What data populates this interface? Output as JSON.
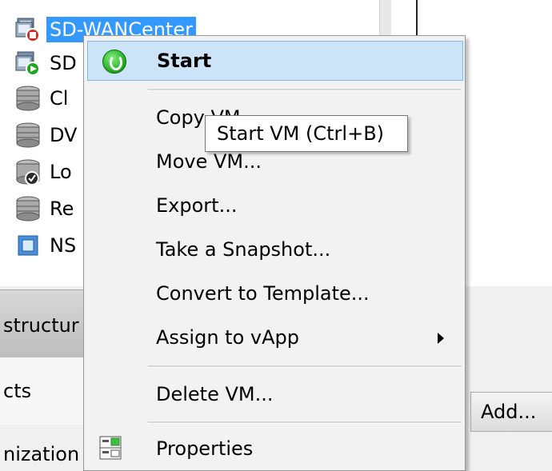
{
  "tree": {
    "items": [
      {
        "label": "SD-WANCenter",
        "icon": "vm-stopped-icon",
        "selected": true
      },
      {
        "label": "SD",
        "icon": "vm-running-icon"
      },
      {
        "label": "Cl",
        "icon": "server-stack-icon"
      },
      {
        "label": "DV",
        "icon": "server-stack-icon"
      },
      {
        "label": "Lo",
        "icon": "server-check-icon"
      },
      {
        "label": "Re",
        "icon": "server-stack-icon"
      },
      {
        "label": "NS",
        "icon": "template-icon"
      }
    ]
  },
  "bottom_nav": {
    "infrastructure": "structur",
    "objects": "cts",
    "organization": "nization",
    "add_button": "Add..."
  },
  "context_menu": {
    "items": [
      {
        "label": "Start",
        "icon": "start-icon",
        "highlighted": true
      },
      {
        "label": "Copy VM..."
      },
      {
        "label": "Move VM..."
      },
      {
        "label": "Export..."
      },
      {
        "label": "Take a Snapshot..."
      },
      {
        "label": "Convert to Template..."
      },
      {
        "label": "Assign to vApp",
        "submenu": true
      },
      {
        "label": "Delete VM..."
      },
      {
        "label": "Properties",
        "icon": "properties-icon"
      }
    ]
  },
  "tooltip": {
    "text": "Start VM (Ctrl+B)"
  },
  "colors": {
    "selection": "#3399ff",
    "menu_highlight": "#cce4f7",
    "menu_bg": "#f2f2f2"
  }
}
